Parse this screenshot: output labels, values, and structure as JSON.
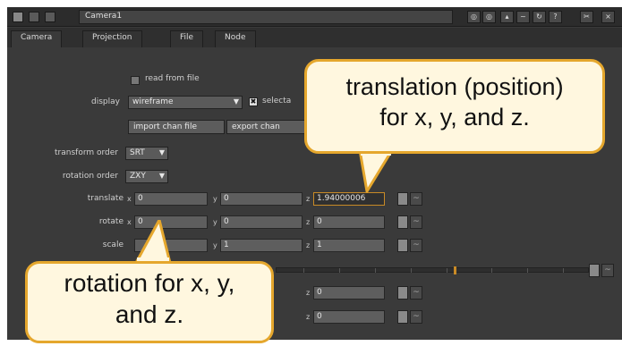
{
  "window": {
    "title": "Camera1",
    "titlebar_buttons": [
      "◎",
      "◎",
      "▴",
      "~",
      "↻",
      "?",
      "✂",
      "×"
    ]
  },
  "tabs": [
    "Camera",
    "Projection",
    "File",
    "Node"
  ],
  "form": {
    "read_from_file": "read from file",
    "display_label": "display",
    "display_value": "wireframe",
    "selectable_label": "selecta",
    "import_btn": "import chan file",
    "export_btn": "export chan",
    "transform_order_label": "transform order",
    "transform_order_value": "SRT",
    "rotation_order_label": "rotation order",
    "rotation_order_value": "ZXY",
    "translate_label": "translate",
    "rotate_label": "rotate",
    "scale_label": "scale",
    "axis_x": "x",
    "axis_y": "y",
    "axis_z": "z",
    "translate": {
      "x": "0",
      "y": "0",
      "z": "1.94000006"
    },
    "rotate": {
      "x": "0",
      "y": "0",
      "z": "0"
    },
    "scale": {
      "x": "",
      "y": "1",
      "z": "1"
    },
    "extra1": "0",
    "extra2": "0"
  },
  "callouts": {
    "translation_line1": "translation (position)",
    "translation_line2": "for x, y, and z.",
    "rotation_line1": "rotation for x, y,",
    "rotation_line2": "and z."
  },
  "colors": {
    "callout_border": "#e5a72d",
    "callout_fill": "#fff7df",
    "panel_bg": "#3a3a3a"
  }
}
